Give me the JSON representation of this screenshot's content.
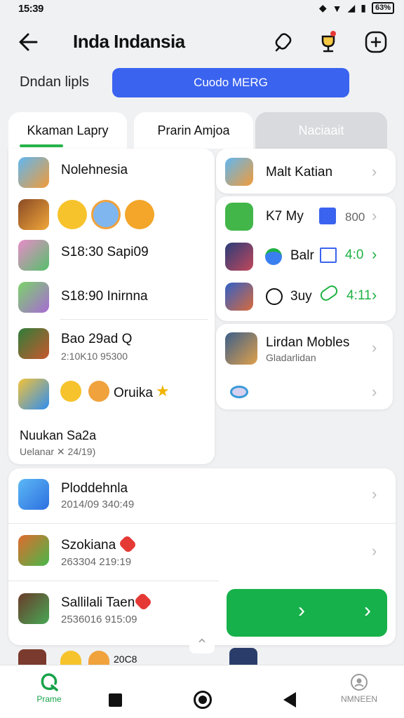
{
  "status_bar": {
    "time": "15:39",
    "battery": "63%"
  },
  "header": {
    "title": "Inda Indansia"
  },
  "sub_label": "Dndan lipls",
  "primary_button": "Cuodo MERG",
  "tabs": [
    {
      "label": "Kkaman Lapry"
    },
    {
      "label": "Prarin Amjoa"
    },
    {
      "label": "Naciaait"
    }
  ],
  "left_card": {
    "rows": [
      {
        "title": "Nolehnesia"
      },
      {
        "title": ""
      },
      {
        "title": "S18:30 Sapi09"
      },
      {
        "title": "S18:90 Inirnna"
      },
      {
        "title": "Bao 29ad Q",
        "sub": "2:10K10 95300"
      },
      {
        "title": "Oruika"
      }
    ],
    "footer_title": "Nuukan Sa2a",
    "footer_sub": "Uelanar ✕ 24/19)"
  },
  "right_card_top": {
    "title": "Malt Katian"
  },
  "right_card_mid": {
    "rows": [
      {
        "title": "K7 My",
        "value": "800"
      },
      {
        "title": "Balr",
        "value": "4:0"
      },
      {
        "title": "3uy",
        "value": "4:11"
      }
    ]
  },
  "right_card_bottom": {
    "title": "Lirdan Mobles",
    "sub": "Gladarlidan"
  },
  "list_card": {
    "rows": [
      {
        "title": "Ploddehnla",
        "sub": "2014/09 340:49"
      },
      {
        "title": "Szokiana",
        "sub": "263304 219:19"
      },
      {
        "title": "Sallilali Taen",
        "sub": "2536016 915:09"
      }
    ]
  },
  "peek_row": {
    "title": "20C8"
  },
  "bottom_nav": {
    "left_label": "Prame",
    "right_label": "NMNEEN"
  },
  "colors": {
    "accent_blue": "#3a63ef",
    "accent_green": "#16b14a",
    "background": "#f0f1f3"
  },
  "icons": [
    "back-arrow",
    "pin",
    "trophy",
    "add"
  ]
}
